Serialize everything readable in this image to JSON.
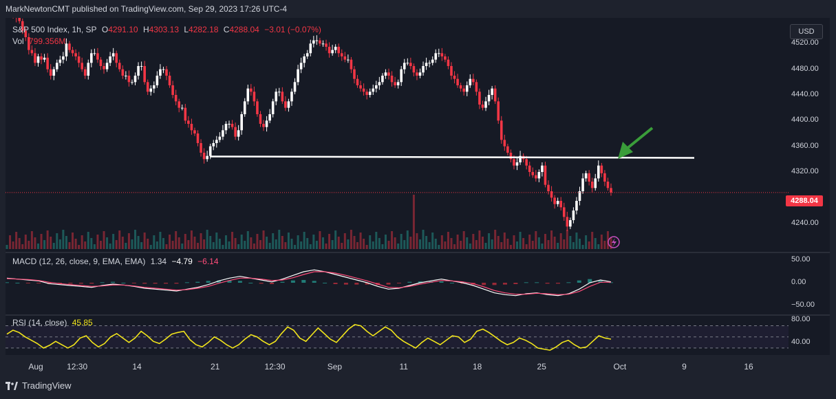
{
  "header": {
    "publisher_text": "MarkNewtonCMT published on TradingView.com, Sep 29, 2023 17:26 UTC-4"
  },
  "footer": {
    "brand": "TradingView"
  },
  "price_pane": {
    "symbol": "S&P 500 Index, 1h, SP",
    "open_label": "O",
    "open": "4291.10",
    "high_label": "H",
    "high": "4303.13",
    "low_label": "L",
    "low": "4282.18",
    "close_label": "C",
    "close": "4288.04",
    "change": "−3.01 (−0.07%)",
    "vol_label": "Vol",
    "vol_value": "799.356M",
    "currency": "USD",
    "last_price_tag": "4288.04"
  },
  "macd_pane": {
    "label": "MACD (12, 26, close, 9, EMA, EMA)",
    "macd": "1.34",
    "signal": "−4.79",
    "hist": "−6.14"
  },
  "rsi_pane": {
    "label": "RSI (14, close)",
    "value": "45.85"
  },
  "colors": {
    "up": "#ffffff",
    "down": "#f23645",
    "bg": "#161a25",
    "macd_line": "#ffffff",
    "signal_line": "#ff4d7a",
    "rsi": "#f2e51b",
    "arrow": "#3a9d3a",
    "support": "#ffffff"
  },
  "chart_data": [
    {
      "type": "line",
      "title": "S&P 500 Index, 1h, SP",
      "x": [
        "Aug",
        "12:30",
        "14",
        "21",
        "12:30",
        "Sep",
        "11",
        "18",
        "25",
        "Oct",
        "9",
        "16"
      ],
      "x_anchor_ranks": [
        0,
        9,
        22,
        39,
        52,
        65,
        80,
        96,
        110,
        127,
        141,
        155
      ],
      "series": [
        {
          "values_hourly_close_approx": [
            4580,
            4572,
            4565,
            4560,
            4555,
            4540,
            4530,
            4510,
            4505,
            4490,
            4500,
            4495,
            4498,
            4480,
            4470,
            4480,
            4490,
            4495,
            4500,
            4520,
            4510,
            4505,
            4500,
            4490,
            4480,
            4470,
            4490,
            4505,
            4505,
            4495,
            4485,
            4480,
            4490,
            4500,
            4505,
            4490,
            4480,
            4470,
            4470,
            4460,
            4460,
            4470,
            4485,
            4485,
            4460,
            4445,
            4450,
            4455,
            4470,
            4480,
            4480,
            4470,
            4455,
            4440,
            4430,
            4420,
            4420,
            4400,
            4395,
            4385,
            4380,
            4365,
            4350,
            4340,
            4345,
            4360,
            4365,
            4370,
            4375,
            4385,
            4395,
            4395,
            4390,
            4375,
            4385,
            4410,
            4430,
            4450,
            4445,
            4430,
            4410,
            4395,
            4390,
            4400,
            4410,
            4430,
            4445,
            4445,
            4430,
            4420,
            4430,
            4445,
            4460,
            4480,
            4490,
            4500,
            4505,
            4520,
            4525,
            4525,
            4520,
            4520,
            4515,
            4505,
            4510,
            4515,
            4505,
            4500,
            4495,
            4495,
            4480,
            4465,
            4455,
            4450,
            4445,
            4440,
            4445,
            4450,
            4455,
            4460,
            4470,
            4475,
            4470,
            4460,
            4455,
            4460,
            4480,
            4490,
            4490,
            4485,
            4475,
            4470,
            4475,
            4485,
            4490,
            4490,
            4495,
            4505,
            4505,
            4500,
            4495,
            4485,
            4470,
            4465,
            4455,
            4450,
            4445,
            4455,
            4465,
            4460,
            4445,
            4425,
            4420,
            4430,
            4440,
            4450,
            4430,
            4400,
            4370,
            4360,
            4350,
            4340,
            4330,
            4335,
            4345,
            4340,
            4330,
            4320,
            4315,
            4310,
            4320,
            4330,
            4300,
            4290,
            4280,
            4270,
            4275,
            4265,
            4250,
            4235,
            4245,
            4260,
            4275,
            4290,
            4310,
            4318,
            4305,
            4295,
            4310,
            4330,
            4318,
            4305,
            4295,
            4288
          ]
        }
      ],
      "ylim": [
        4200,
        4560
      ],
      "yticks": [
        4520.0,
        4480.0,
        4440.0,
        4400.0,
        4360.0,
        4320.0,
        4240.0
      ],
      "support_level": 4342,
      "grid": false
    },
    {
      "type": "line",
      "title": "MACD (12, 26, close, 9, EMA, EMA)",
      "ylim": [
        -60,
        60
      ],
      "yticks": [
        50.0,
        0.0,
        -50.0
      ],
      "series": [
        {
          "name": "MACD",
          "values": [
            10,
            8,
            6,
            4,
            -2,
            -4,
            -6,
            -8,
            -10,
            -6,
            -3,
            -5,
            -8,
            -12,
            -14,
            -16,
            -18,
            -14,
            -10,
            -4,
            4,
            10,
            14,
            10,
            6,
            2,
            8,
            16,
            24,
            28,
            24,
            18,
            12,
            6,
            0,
            -8,
            -14,
            -12,
            -6,
            0,
            4,
            8,
            4,
            0,
            -6,
            -14,
            -22,
            -26,
            -28,
            -24,
            -22,
            -26,
            -28,
            -24,
            -14,
            0,
            6,
            2
          ]
        },
        {
          "name": "Signal",
          "values": [
            9,
            8,
            7,
            5,
            1,
            -2,
            -4,
            -6,
            -8,
            -7,
            -5,
            -5,
            -7,
            -10,
            -12,
            -14,
            -16,
            -15,
            -12,
            -8,
            -1,
            5,
            10,
            10,
            8,
            5,
            6,
            11,
            18,
            24,
            24,
            21,
            16,
            10,
            4,
            -3,
            -10,
            -11,
            -8,
            -3,
            1,
            5,
            4,
            2,
            -2,
            -9,
            -17,
            -22,
            -25,
            -25,
            -23,
            -24,
            -26,
            -25,
            -19,
            -8,
            1,
            1
          ]
        }
      ],
      "histogram": [
        1,
        0,
        -1,
        -1,
        -3,
        -2,
        -2,
        -2,
        -2,
        1,
        2,
        0,
        -1,
        -2,
        -2,
        -2,
        -2,
        1,
        2,
        4,
        5,
        5,
        4,
        0,
        -2,
        -3,
        2,
        5,
        6,
        4,
        0,
        -3,
        -4,
        -4,
        -4,
        -5,
        -4,
        -1,
        2,
        3,
        3,
        3,
        0,
        -2,
        -4,
        -5,
        -5,
        -4,
        -3,
        1,
        1,
        -2,
        -2,
        1,
        5,
        8,
        5,
        1
      ]
    },
    {
      "type": "line",
      "title": "RSI (14, close)",
      "ylim": [
        20,
        88
      ],
      "yticks": [
        80.0,
        40.0
      ],
      "bands": [
        70,
        50,
        30
      ],
      "series": [
        {
          "name": "RSI",
          "values": [
            55,
            62,
            58,
            50,
            44,
            38,
            30,
            35,
            42,
            36,
            30,
            36,
            48,
            52,
            40,
            32,
            38,
            50,
            56,
            48,
            40,
            48,
            60,
            52,
            42,
            38,
            46,
            55,
            58,
            60,
            45,
            36,
            32,
            40,
            50,
            44,
            36,
            30,
            36,
            46,
            54,
            50,
            42,
            36,
            42,
            56,
            68,
            62,
            48,
            42,
            54,
            66,
            56,
            46,
            40,
            52,
            64,
            72,
            70,
            60,
            52,
            60,
            68,
            62,
            50,
            42,
            36,
            30,
            40,
            48,
            42,
            36,
            44,
            52,
            50,
            40,
            46,
            60,
            64,
            58,
            50,
            42,
            36,
            40,
            48,
            44,
            38,
            30,
            28,
            26,
            32,
            40,
            44,
            36,
            30,
            32,
            42,
            52,
            48,
            46
          ]
        }
      ]
    }
  ]
}
